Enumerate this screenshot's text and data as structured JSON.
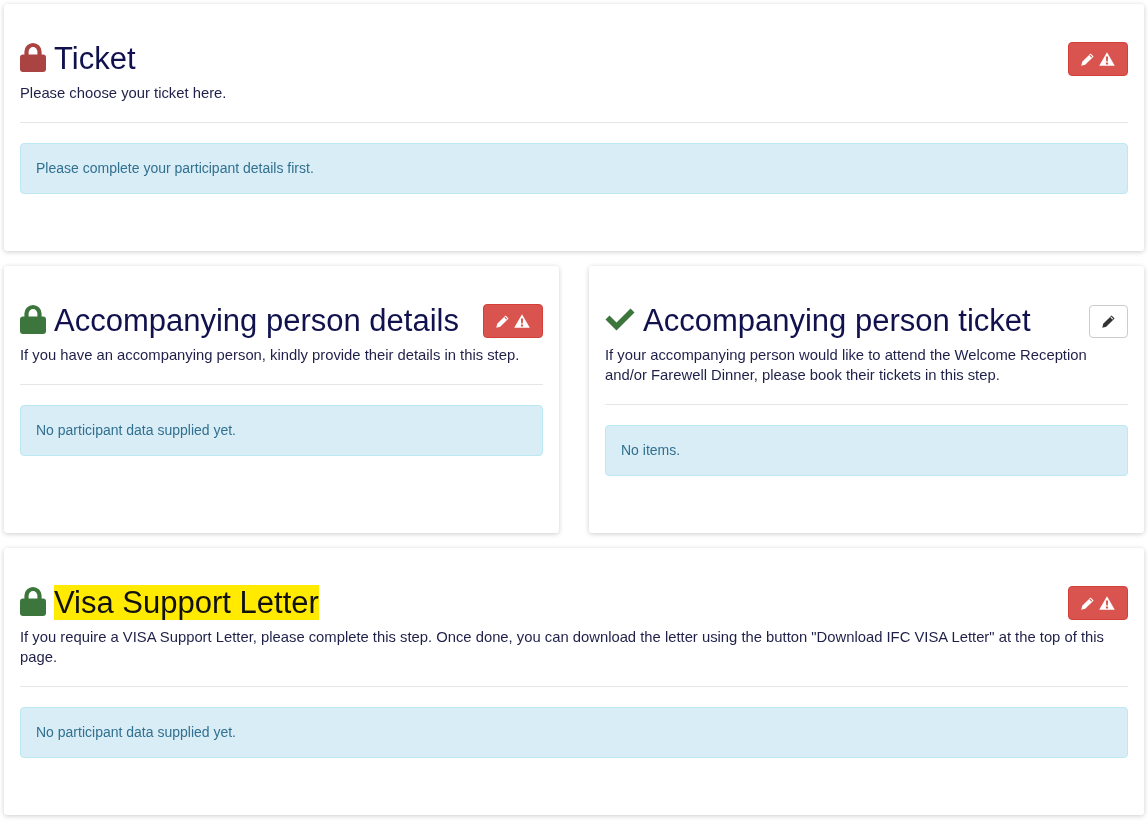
{
  "rows": [
    {
      "steps": [
        {
          "status_icon": {
            "kind": "lock",
            "color": "#a94442"
          },
          "title": "Ticket",
          "title_highlighted": false,
          "description": "Please choose your ticket here.",
          "edit_button": {
            "warning": true
          },
          "message": "Please complete your participant details first."
        }
      ]
    },
    {
      "steps": [
        {
          "status_icon": {
            "kind": "lock",
            "color": "#3c763d"
          },
          "title": "Accompanying person details",
          "title_highlighted": false,
          "description": "If you have an accompanying person, kindly provide their details in this step.",
          "edit_button": {
            "warning": true
          },
          "message": "No participant data supplied yet."
        },
        {
          "status_icon": {
            "kind": "check",
            "color": "#3c763d"
          },
          "title": "Accompanying person ticket",
          "title_highlighted": false,
          "description": "If your accompanying person would like to attend the Welcome Reception and/or Farewell Dinner, please book their tickets in this step.",
          "edit_button": {
            "warning": false
          },
          "message": "No items."
        }
      ]
    },
    {
      "steps": [
        {
          "status_icon": {
            "kind": "lock",
            "color": "#3c763d"
          },
          "title": "Visa Support Letter",
          "title_highlighted": true,
          "description": "If you require a VISA Support Letter, please complete this step. Once done, you can download the letter using the button \"Download IFC VISA Letter\" at the top of this page.",
          "edit_button": {
            "warning": true
          },
          "message": "No participant data supplied yet."
        }
      ]
    }
  ]
}
